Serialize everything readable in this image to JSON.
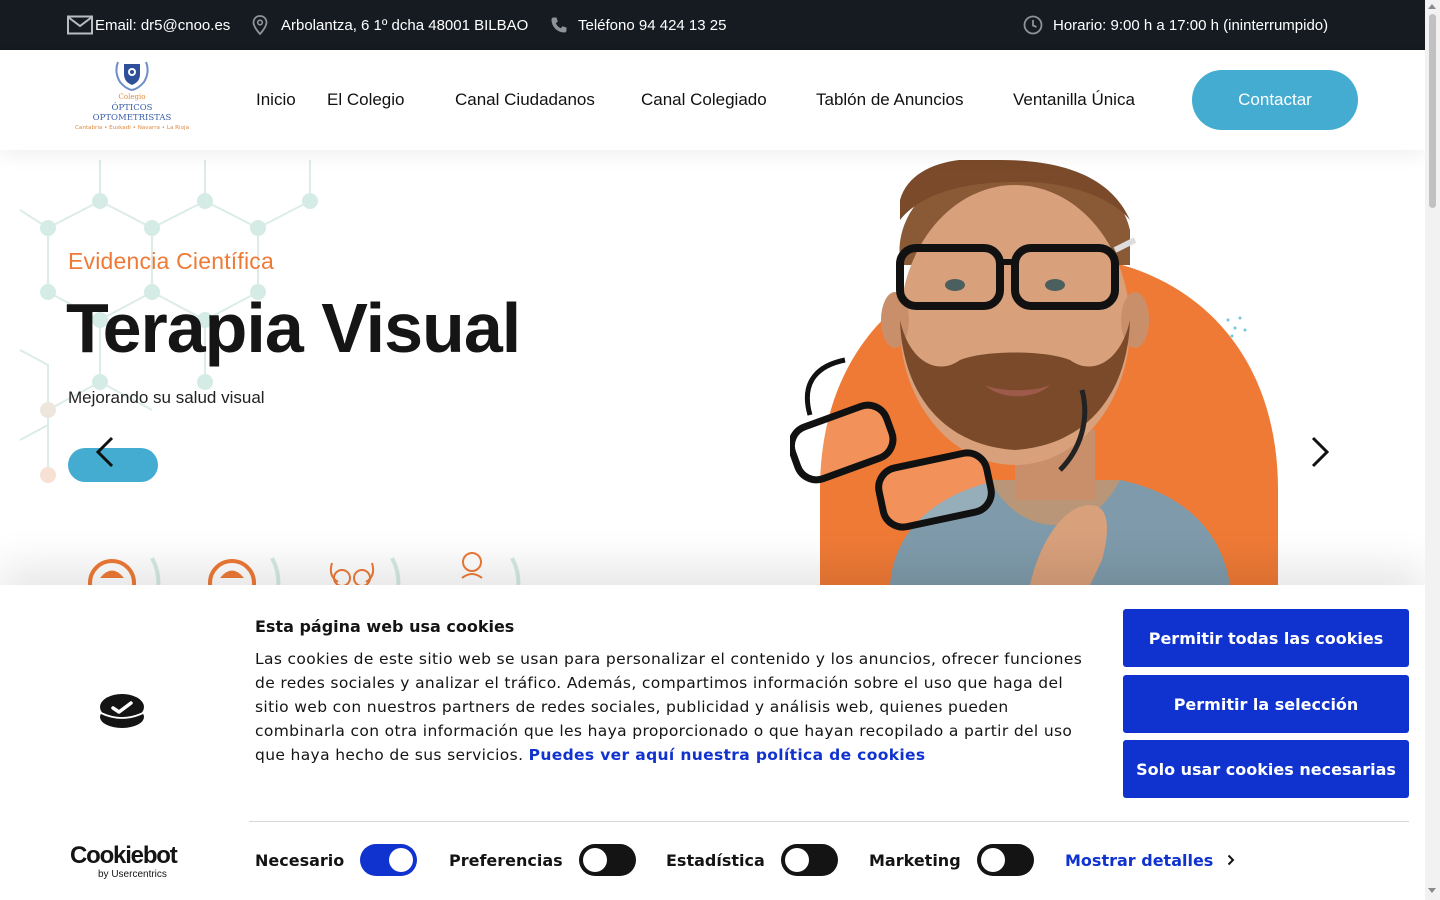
{
  "topbar": {
    "email": "Email: dr5@cnoo.es",
    "address": "Arbolantza, 6 1º dcha 48001 BILBAO",
    "phone": "Teléfono 94 424 13 25",
    "hours": "Horario: 9:00 h a 17:00 h (ininterrumpido)",
    "icons": [
      "mail-icon",
      "location-pin-icon",
      "phone-icon",
      "clock-icon"
    ]
  },
  "logo": {
    "line1": "Colegio",
    "line2": "ÓPTICOS",
    "line3": "OPTOMETRISTAS",
    "line4": "Cantabria • Euskadi • Navarra • La Rioja"
  },
  "nav": {
    "items": [
      "Inicio",
      "El Colegio",
      "Canal Ciudadanos",
      "Canal Colegiado",
      "Tablón de Anuncios",
      "Ventanilla Única"
    ],
    "contact": "Contactar"
  },
  "hero": {
    "subtitle": "Evidencia Científica",
    "title": "Terapia Visual",
    "description": "Mejorando su salud visual",
    "accent_color": "#ef7a36",
    "button_color": "#44acd1"
  },
  "cookie": {
    "title": "Esta página web usa cookies",
    "text": "Las cookies de este sitio web se usan para personalizar el contenido y los anuncios, ofrecer funciones de redes sociales y analizar el tráfico. Además, compartimos información sobre el uso que haga del sitio web con nuestros partners de redes sociales, publicidad y análisis web, quienes pueden combinarla con otra información que les haya proporcionado o que hayan recopilado a partir del uso que haya hecho de sus servicios.",
    "link": "Puedes ver aquí nuestra política de cookies",
    "buttons": {
      "allow_all": "Permitir todas las cookies",
      "allow_selection": "Permitir la selección",
      "necessary_only": "Solo usar cookies necesarias"
    },
    "toggles": [
      {
        "label": "Necesario",
        "on": true
      },
      {
        "label": "Preferencias",
        "on": false
      },
      {
        "label": "Estadística",
        "on": false
      },
      {
        "label": "Marketing",
        "on": false
      }
    ],
    "show_details": "Mostrar detalles",
    "brand": "Cookiebot",
    "brand_by": "by Usercentrics",
    "brand_color": "#1032cf"
  }
}
